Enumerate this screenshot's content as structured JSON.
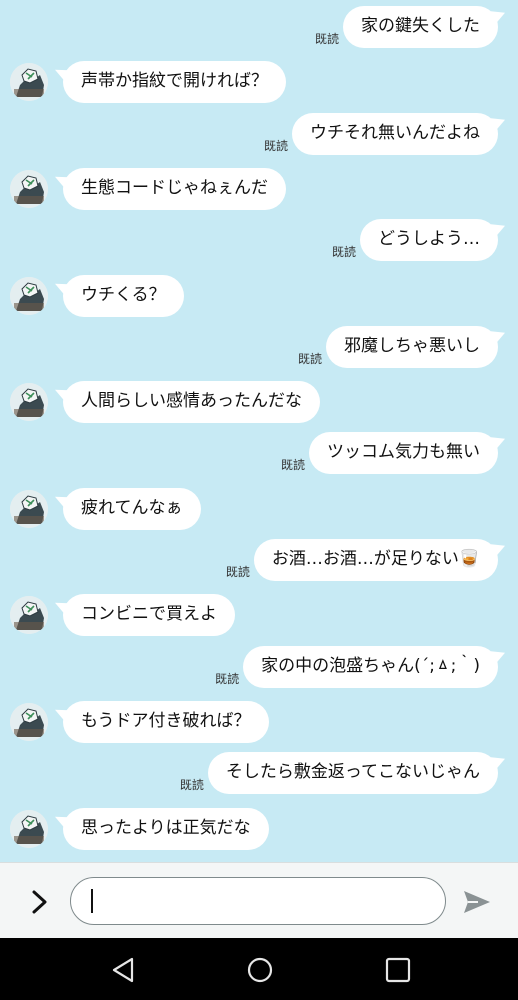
{
  "read_label": "既読",
  "messages": [
    {
      "side": "me",
      "text": "家の鍵失くした"
    },
    {
      "side": "them",
      "text": "声帯か指紋で開ければ？"
    },
    {
      "side": "me",
      "text": "ウチそれ無いんだよね"
    },
    {
      "side": "them",
      "text": "生態コードじゃねぇんだ"
    },
    {
      "side": "me",
      "text": "どうしよう…"
    },
    {
      "side": "them",
      "text": "ウチくる？"
    },
    {
      "side": "me",
      "text": "邪魔しちゃ悪いし"
    },
    {
      "side": "them",
      "text": "人間らしい感情あったんだな"
    },
    {
      "side": "me",
      "text": "ツッコム気力も無い"
    },
    {
      "side": "them",
      "text": "疲れてんなぁ"
    },
    {
      "side": "me",
      "text": "お酒…お酒…が足りない🥃"
    },
    {
      "side": "them",
      "text": "コンビニで買えよ"
    },
    {
      "side": "me",
      "text": "家の中の泡盛ちゃん(´;ㅿ;｀)"
    },
    {
      "side": "them",
      "text": "もうドア付き破れば？"
    },
    {
      "side": "me",
      "text": "そしたら敷金返ってこないじゃん"
    },
    {
      "side": "them",
      "text": "思ったよりは正気だな"
    }
  ],
  "input": {
    "value": "",
    "placeholder": ""
  },
  "icons": {
    "expand": "chevron-right-icon",
    "send": "send-icon",
    "nav_back": "back-triangle-icon",
    "nav_home": "home-circle-icon",
    "nav_recents": "recents-square-icon",
    "avatar": "avatar-icon"
  },
  "colors": {
    "background": "#c7eaf4",
    "bubble": "#ffffff",
    "input_bar": "#f4f6f6",
    "nav_bar": "#000000",
    "send": "#8a9294"
  }
}
